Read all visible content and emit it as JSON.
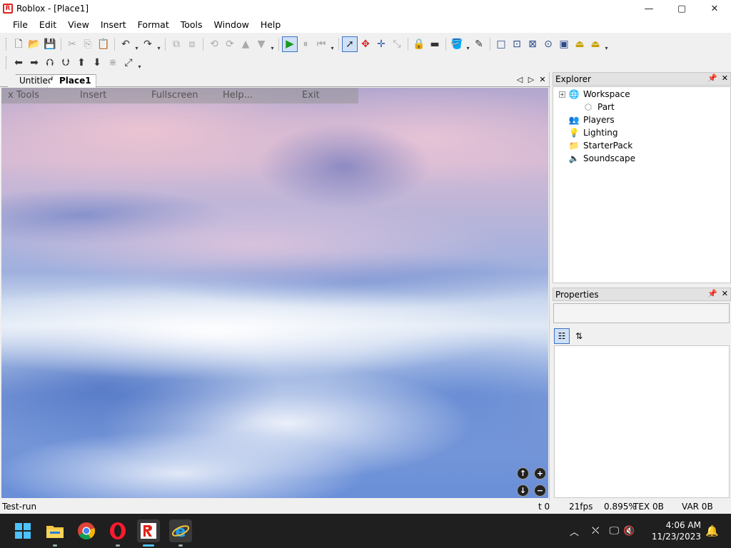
{
  "window": {
    "title": "Roblox - [Place1]",
    "app_icon_letter": "R",
    "controls": {
      "minimize": "—",
      "maximize": "▢",
      "close": "✕"
    }
  },
  "menubar": [
    "File",
    "Edit",
    "View",
    "Insert",
    "Format",
    "Tools",
    "Window",
    "Help"
  ],
  "tabs": {
    "items": [
      {
        "label": "Untitled",
        "active": false
      },
      {
        "label": "Place1",
        "active": true
      }
    ]
  },
  "game_menu": {
    "items": [
      "x Tools",
      "Insert",
      "Fullscreen",
      "Help...",
      "Exit"
    ]
  },
  "explorer": {
    "title": "Explorer",
    "tree": [
      {
        "label": "Workspace",
        "icon": "globe-icon",
        "expander": "+",
        "indent": 0
      },
      {
        "label": "Part",
        "icon": "part-icon",
        "expander": "",
        "indent": 1
      },
      {
        "label": "Players",
        "icon": "players-icon",
        "expander": "",
        "indent": 0
      },
      {
        "label": "Lighting",
        "icon": "lightbulb-icon",
        "expander": "",
        "indent": 0
      },
      {
        "label": "StarterPack",
        "icon": "folder-icon",
        "expander": "",
        "indent": 0
      },
      {
        "label": "Soundscape",
        "icon": "speaker-icon",
        "expander": "",
        "indent": 0
      }
    ]
  },
  "properties": {
    "title": "Properties"
  },
  "statusbar": {
    "mode": "Test-run",
    "t": "t 0",
    "fps": "21fps",
    "percent": "0.895%",
    "tex": "TEX 0B",
    "var": "VAR 0B"
  },
  "taskbar": {
    "time": "4:06 AM",
    "date": "11/23/2023"
  },
  "colors": {
    "accent": "#3b73c8",
    "play_green": "#1a9a1a",
    "taskbar": "#1f1f1f"
  }
}
